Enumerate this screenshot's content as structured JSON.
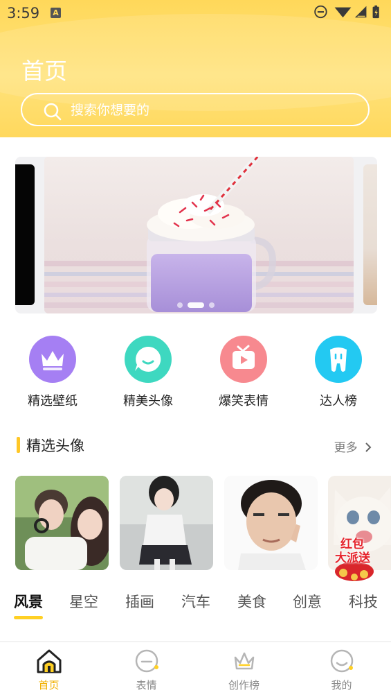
{
  "status_bar": {
    "time": "3:59",
    "notification_icon": "A"
  },
  "header": {
    "title": "首页",
    "search_placeholder": "搜索你想要的"
  },
  "carousel": {
    "dot_count": 3,
    "active_dot": 1
  },
  "categories": [
    {
      "label": "精选壁纸",
      "icon": "crown-icon",
      "color": "#a57ff3"
    },
    {
      "label": "精美头像",
      "icon": "chat-smile-icon",
      "color": "#3ed8c0"
    },
    {
      "label": "爆笑表情",
      "icon": "tv-play-icon",
      "color": "#f7898f"
    },
    {
      "label": "达人榜",
      "icon": "tooth-icon",
      "color": "#23c9f2"
    }
  ],
  "featured": {
    "title": "精选头像",
    "more_label": "更多"
  },
  "promo_badge": {
    "line1": "红包",
    "line2": "大派送"
  },
  "tabs": [
    "风景",
    "星空",
    "插画",
    "汽车",
    "美食",
    "创意",
    "科技"
  ],
  "bottom_nav": [
    {
      "label": "首页",
      "icon": "home-icon",
      "active": true
    },
    {
      "label": "表情",
      "icon": "emoji-icon",
      "active": false
    },
    {
      "label": "创作榜",
      "icon": "crown-outline-icon",
      "active": false
    },
    {
      "label": "我的",
      "icon": "profile-icon",
      "active": false
    }
  ],
  "colors": {
    "accent": "#ffd85a",
    "active_tab": "#f2b000",
    "tab_underline": "#ffd024"
  }
}
